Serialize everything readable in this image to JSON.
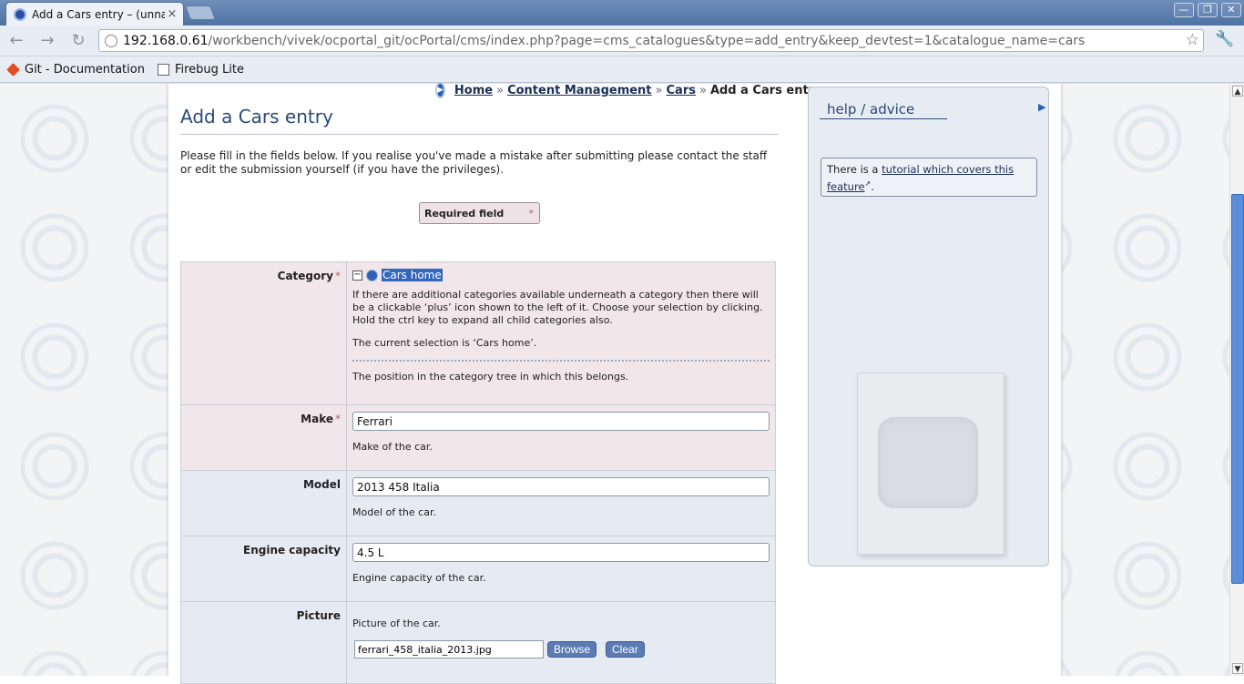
{
  "browser": {
    "tab_title": "Add a Cars entry – (unnam",
    "tab_close": "×",
    "url_host": "192.168.0.61",
    "url_path": "/workbench/vivek/ocportal_git/ocPortal/cms/index.php?page=cms_catalogues&type=add_entry&keep_devtest=1&catalogue_name=cars",
    "window_buttons": [
      "—",
      "❐",
      "✕"
    ],
    "bookmarks": [
      "Git - Documentation",
      "Firebug Lite"
    ]
  },
  "breadcrumb": {
    "items": [
      "Home",
      "Content Management",
      "Cars"
    ],
    "separator": "»",
    "current": "Add a Cars entry"
  },
  "page": {
    "title": "Add a Cars entry",
    "intro": "Please fill in the fields below. If you realise you've made a mistake after submitting please contact the staff or edit the submission yourself (if you have the privileges).",
    "required_legend": "Required field",
    "required_mark": "*"
  },
  "form": {
    "category": {
      "label": "Category",
      "selected": "Cars home",
      "help": "If there are additional categories available underneath a category then there will be a clickable ‘plus’ icon shown to the left of it. Choose your selection by clicking. Hold the ctrl key to expand all child categories also.",
      "current": "The current selection is ‘Cars home’.",
      "description": "The position in the category tree in which this belongs."
    },
    "make": {
      "label": "Make",
      "value": "Ferrari",
      "description": "Make of the car."
    },
    "model": {
      "label": "Model",
      "value": "2013 458 Italia",
      "description": "Model of the car."
    },
    "engine": {
      "label": "Engine capacity",
      "value": "4.5 L",
      "description": "Engine capacity of the car."
    },
    "picture": {
      "label": "Picture",
      "description": "Picture of the car.",
      "file": "ferrari_458_italia_2013.jpg",
      "browse": "Browse",
      "clear": "Clear"
    }
  },
  "sidebar": {
    "title": "help / advice",
    "advice_prefix": "There is a ",
    "advice_link": "tutorial which covers this feature",
    "advice_suffix": "."
  }
}
